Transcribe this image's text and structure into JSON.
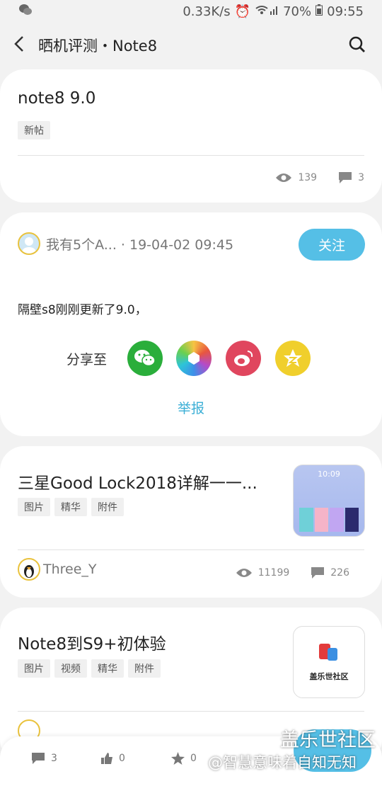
{
  "status": {
    "speed": "0.33K/s",
    "battery": "70%",
    "time": "09:55"
  },
  "header": {
    "title": "晒机评测・Note8"
  },
  "post": {
    "title": "note8 9.0",
    "tags": [
      "新帖"
    ],
    "views": "139",
    "comments": "3"
  },
  "reply": {
    "author_meta": "我有5个A... · 19-04-02 09:45",
    "follow_label": "关注",
    "body": "隔壁s8刚刚更新了9.0，",
    "share_label": "分享至",
    "report_label": "举报"
  },
  "related": [
    {
      "title": "三星Good Lock2018详解一一...",
      "tags": [
        "图片",
        "精华",
        "附件"
      ],
      "author": "Three_Y",
      "views": "11199",
      "comments": "226",
      "thumb_clock": "10:09"
    },
    {
      "title": "Note8到S9+初体验",
      "tags": [
        "图片",
        "视频",
        "精华",
        "附件"
      ],
      "thumb_text": "盖乐世社区"
    }
  ],
  "bottom": {
    "comments": "3",
    "likes": "0",
    "favorites": "0"
  },
  "watermark": {
    "brand": "盖乐世社区",
    "account": "@智慧意味着自知无知"
  }
}
